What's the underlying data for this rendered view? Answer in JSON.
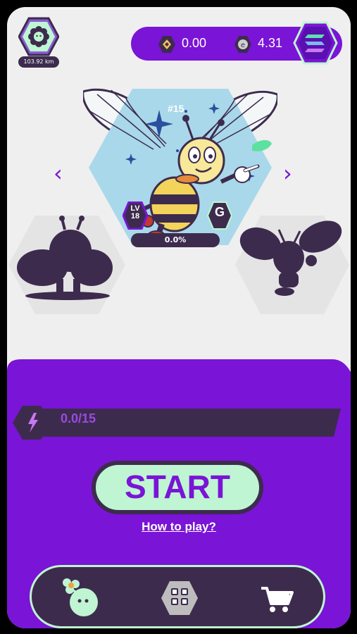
{
  "header": {
    "distance": "103.92 km",
    "coin1_value": "0.00",
    "coin2_value": "4.31",
    "icons": {
      "avatar": "flower-avatar-icon",
      "coin1": "gem-coin-icon",
      "coin2": "e-token-coin-icon",
      "menu": "solana-menu-icon"
    }
  },
  "character": {
    "id_label": "#15",
    "level_label_top": "LV",
    "level_label_bottom": "18",
    "grade": "G",
    "progress": "0.0%",
    "progress_fraction": 0.0
  },
  "energy": {
    "value": "0.0/15",
    "icon": "lightning-icon"
  },
  "actions": {
    "start": "START",
    "how_to_play": "How to play?"
  },
  "bottom_nav": [
    {
      "name": "character",
      "icon": "character-icon"
    },
    {
      "name": "inventory",
      "icon": "inventory-icon"
    },
    {
      "name": "shop",
      "icon": "cart-icon"
    }
  ],
  "colors": {
    "purple": "#7a14d6",
    "dark": "#3d2b4e",
    "mint": "#bff5d2",
    "hex_blue": "#a9d8ea"
  }
}
